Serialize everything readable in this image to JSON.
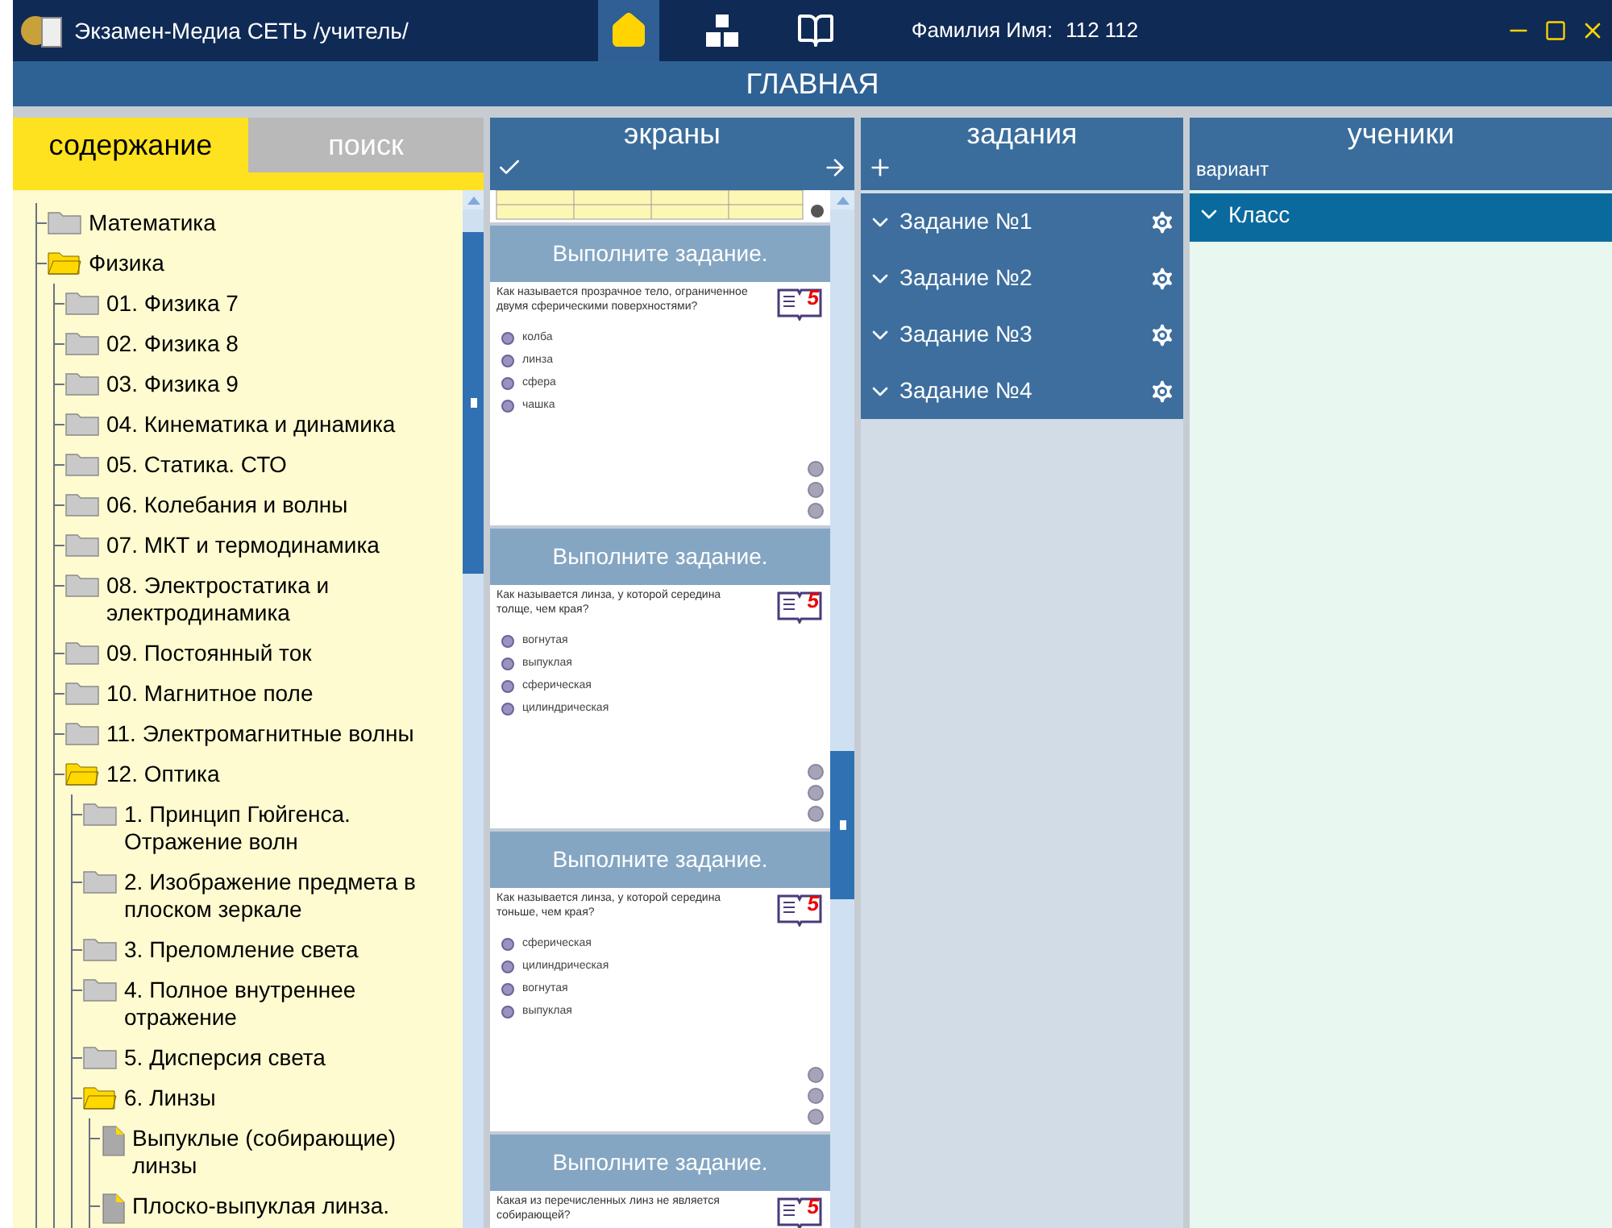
{
  "window": {
    "title": "Экзамен-Медиа СЕТЬ /учитель/",
    "user_label": "Фамилия Имя:",
    "user_value": "112 112"
  },
  "toolbar": [
    {
      "kind": "home",
      "selected": true
    },
    {
      "kind": "hierarchy",
      "selected": false
    },
    {
      "kind": "book",
      "selected": false
    }
  ],
  "page_title": "ГЛАВНАЯ",
  "left_tabs": [
    {
      "label": "содержание",
      "selected": true
    },
    {
      "label": "поиск",
      "selected": false
    }
  ],
  "tree": [
    {
      "kind": "folder",
      "label": "Математика",
      "expanded": false
    },
    {
      "kind": "folder",
      "label": "Физика",
      "expanded": true,
      "children": [
        {
          "kind": "folder",
          "label": "01. Физика 7",
          "expanded": false
        },
        {
          "kind": "folder",
          "label": "02. Физика 8",
          "expanded": false
        },
        {
          "kind": "folder",
          "label": "03. Физика 9",
          "expanded": false
        },
        {
          "kind": "folder",
          "label": "04. Кинематика и динамика",
          "expanded": false
        },
        {
          "kind": "folder",
          "label": "05. Статика. СТО",
          "expanded": false
        },
        {
          "kind": "folder",
          "label": "06. Колебания и волны",
          "expanded": false
        },
        {
          "kind": "folder",
          "label": "07. МКТ и термодинамика",
          "expanded": false
        },
        {
          "kind": "folder",
          "label": "08. Электростатика и электродинамика",
          "expanded": false
        },
        {
          "kind": "folder",
          "label": "09. Постоянный ток",
          "expanded": false
        },
        {
          "kind": "folder",
          "label": "10. Магнитное поле",
          "expanded": false
        },
        {
          "kind": "folder",
          "label": "11. Электромагнитные волны",
          "expanded": false
        },
        {
          "kind": "folder",
          "label": "12. Оптика",
          "expanded": true,
          "children": [
            {
              "kind": "folder",
              "label": "1. Принцип Гюйгенса. Отражение волн",
              "expanded": false
            },
            {
              "kind": "folder",
              "label": "2. Изображение предмета в плоском зеркале",
              "expanded": false
            },
            {
              "kind": "folder",
              "label": "3. Преломление света",
              "expanded": false
            },
            {
              "kind": "folder",
              "label": "4. Полное внутреннее отражение",
              "expanded": false
            },
            {
              "kind": "folder",
              "label": "5. Дисперсия света",
              "expanded": false
            },
            {
              "kind": "folder",
              "label": "6. Линзы",
              "expanded": true,
              "children": [
                {
                  "kind": "document",
                  "label": "Выпуклые (собирающие) линзы"
                },
                {
                  "kind": "document",
                  "label": "Плоско-выпуклая линза."
                }
              ]
            }
          ]
        }
      ]
    }
  ],
  "screens": {
    "title": "экраны",
    "cards": [
      {
        "header": "Выполните задание.",
        "question": "Как называется прозрачное тело, ограниченное двумя сферическими поверхностями?",
        "grade": "5",
        "options": [
          {
            "label": "колба",
            "selected": false
          },
          {
            "label": "линза",
            "selected": false
          },
          {
            "label": "сфера",
            "selected": false
          },
          {
            "label": "чашка",
            "selected": false
          }
        ]
      },
      {
        "header": "Выполните задание.",
        "question": "Как называется линза, у которой середина толще, чем края?",
        "grade": "5",
        "options": [
          {
            "label": "вогнутая",
            "selected": false
          },
          {
            "label": "выпуклая",
            "selected": false
          },
          {
            "label": "сферическая",
            "selected": false
          },
          {
            "label": "цилиндрическая",
            "selected": false
          }
        ]
      },
      {
        "header": "Выполните задание.",
        "question": "Как называется линза, у которой середина тоньше, чем края?",
        "grade": "5",
        "options": [
          {
            "label": "сферическая",
            "selected": false
          },
          {
            "label": "цилиндрическая",
            "selected": false
          },
          {
            "label": "вогнутая",
            "selected": false
          },
          {
            "label": "выпуклая",
            "selected": false
          }
        ]
      },
      {
        "header": "Выполните задание.",
        "question": "Какая из перечисленных линз не является собирающей?",
        "grade": "5"
      }
    ]
  },
  "tasks": {
    "title": "задания",
    "items": [
      {
        "label": "Задание №1"
      },
      {
        "label": "Задание №2"
      },
      {
        "label": "Задание №3"
      },
      {
        "label": "Задание №4"
      }
    ]
  },
  "students": {
    "title": "ученики",
    "subtitle": "вариант",
    "items": [
      {
        "label": "Класс",
        "selected": true
      }
    ]
  }
}
